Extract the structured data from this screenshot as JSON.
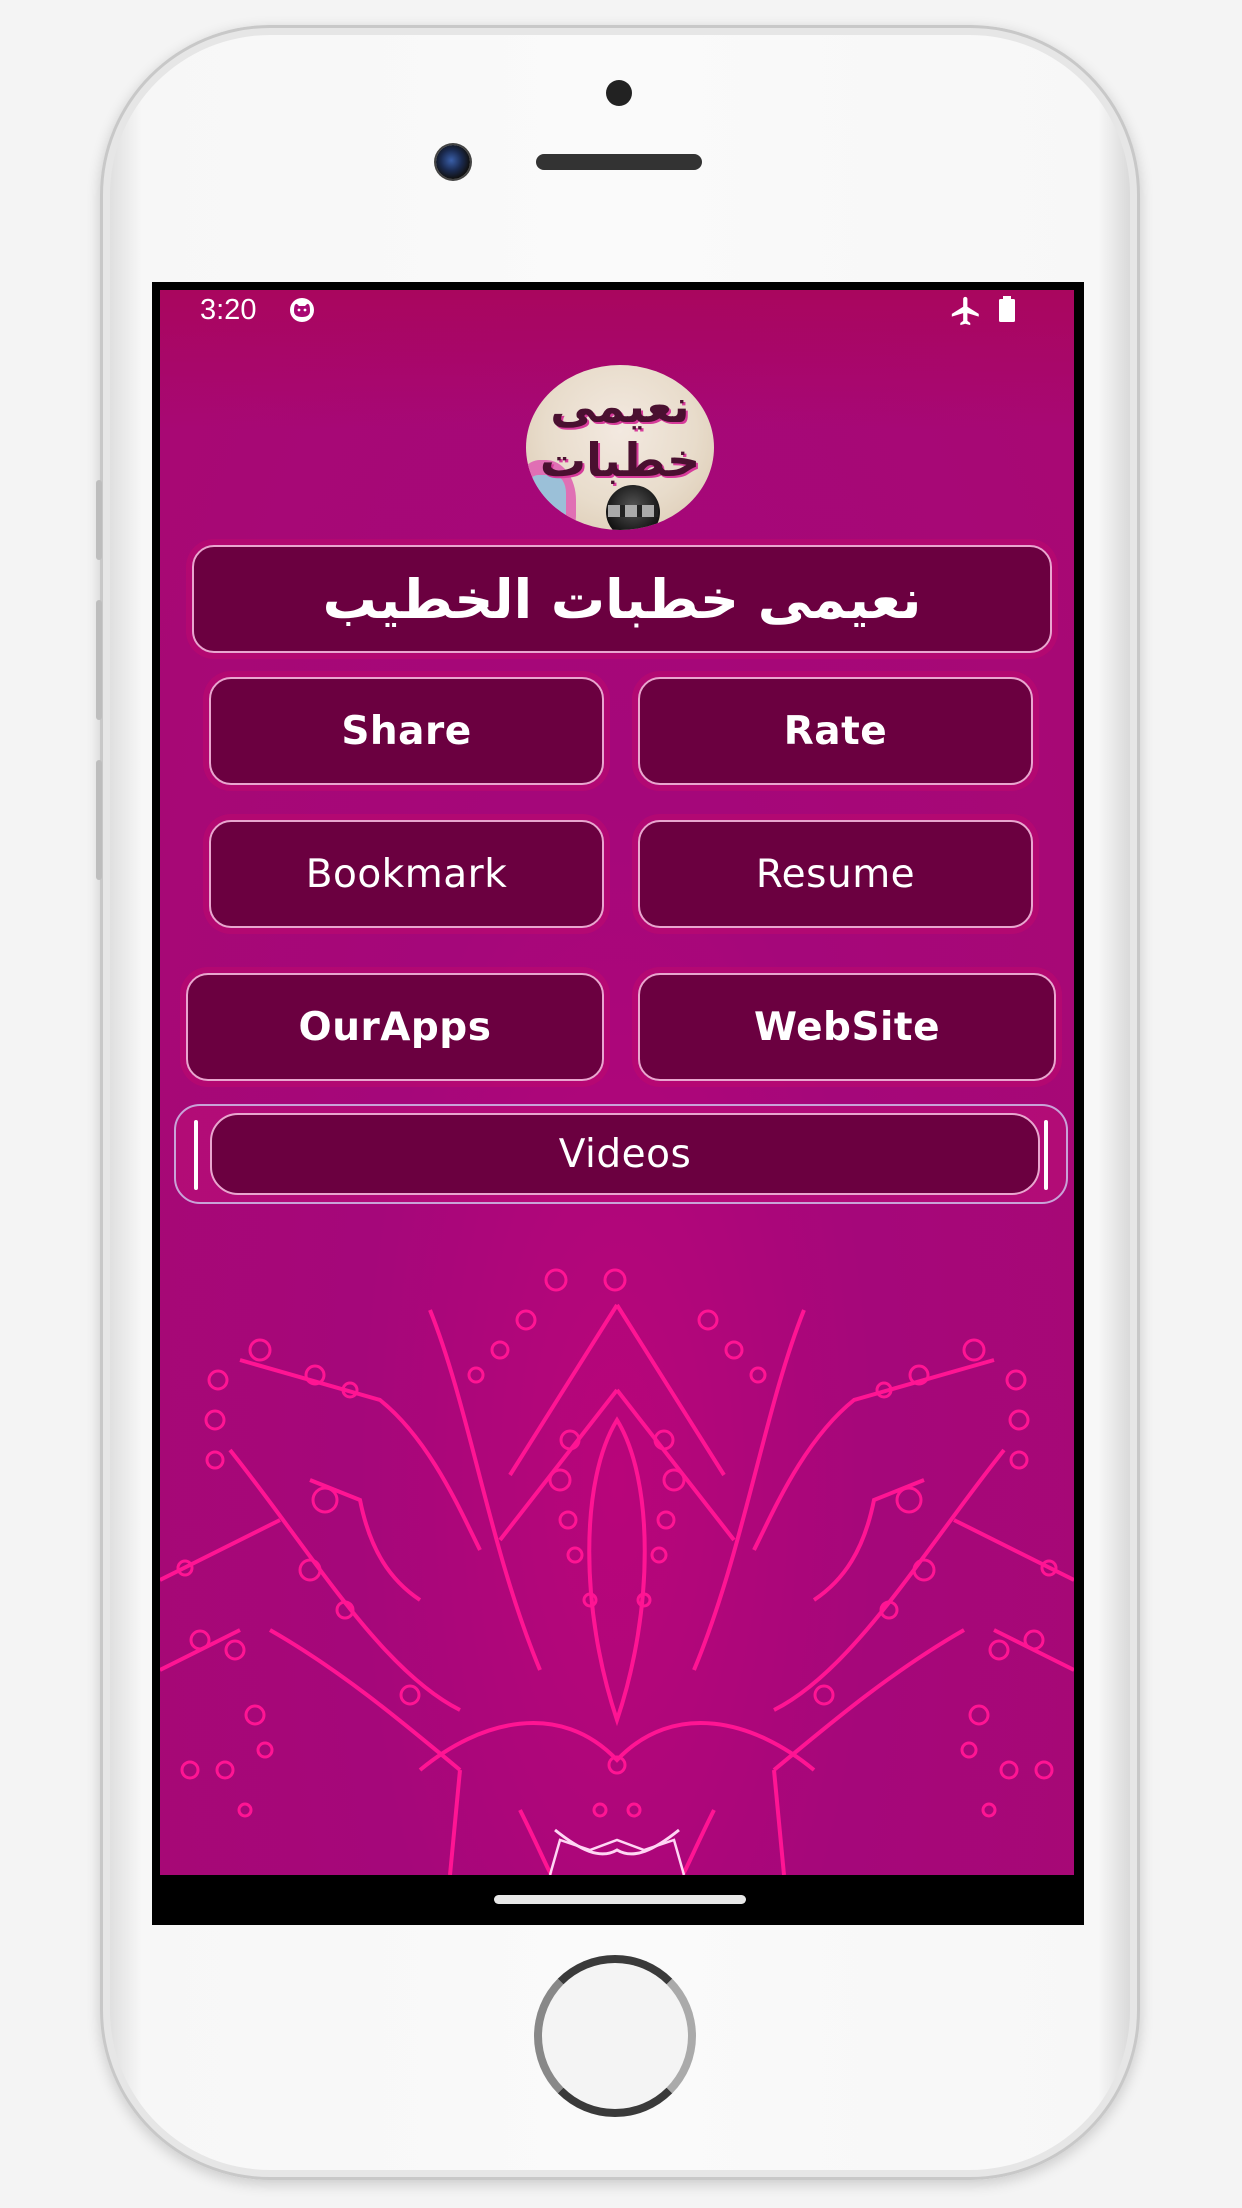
{
  "device": {
    "frame": "white-smartphone",
    "icons": [
      "front-camera",
      "earpiece-speaker",
      "proximity-sensor",
      "home-button"
    ]
  },
  "status_bar": {
    "time": "3:20",
    "left_icons": [
      "cat-notification-icon"
    ],
    "right_icons": [
      "airplane-mode-icon",
      "battery-icon"
    ]
  },
  "app": {
    "logo_text": "نعیمی خطبات",
    "title": "نعیمی خطبات الخطیب",
    "buttons": {
      "share": "Share",
      "rate": "Rate",
      "bookmark": "Bookmark",
      "resume": "Resume",
      "ourapps": "OurApps",
      "website": "WebSite",
      "videos": "Videos"
    },
    "background": "pink-mandala-pattern"
  },
  "colors": {
    "background": "#a80873",
    "button_fill": "#6b0040",
    "button_border": "#e9a6cf",
    "mandala_stroke": "#ff1493",
    "text": "#ffffff"
  }
}
